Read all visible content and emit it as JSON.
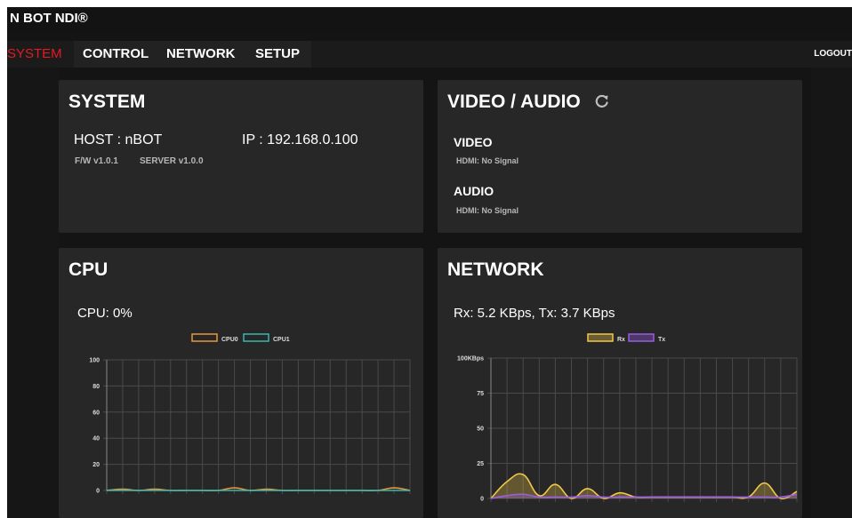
{
  "app": {
    "title": "N BOT NDI®"
  },
  "nav": {
    "tabs": [
      {
        "label": "SYSTEM",
        "active": true
      },
      {
        "label": "CONTROL",
        "active": false
      },
      {
        "label": "NETWORK",
        "active": false
      },
      {
        "label": "SETUP",
        "active": false
      }
    ],
    "logout_label": "LOGOUT"
  },
  "colors": {
    "accent_active_tab": "#e31b23",
    "panel_bg": "#272727",
    "page_bg": "#141414",
    "cpu0": "#e8973a",
    "cpu1": "#38b7b0",
    "rx": "#f0c84a",
    "tx": "#9a5de0"
  },
  "system": {
    "title": "SYSTEM",
    "host_label": "HOST : nBOT",
    "ip_label": "IP : 192.168.0.100",
    "fw_label": "F/W v1.0.1",
    "server_label": "SERVER v1.0.0"
  },
  "video_audio": {
    "title": "VIDEO / AUDIO",
    "refresh_icon": "refresh-icon",
    "video_label": "VIDEO",
    "video_status": "HDMI: No Signal",
    "audio_label": "AUDIO",
    "audio_status": "HDMI: No Signal"
  },
  "cpu": {
    "title": "CPU",
    "usage_label": "CPU: 0%"
  },
  "network": {
    "title": "NETWORK",
    "rate_label": "Rx: 5.2 KBps, Tx: 3.7 KBps"
  },
  "chart_data": [
    {
      "type": "line",
      "name": "cpu",
      "ylim": [
        0,
        100
      ],
      "y_ticks": [
        "0",
        "20",
        "40",
        "60",
        "80",
        "100"
      ],
      "x_count": 20,
      "series": [
        {
          "name": "CPU0",
          "values": [
            0,
            1,
            0,
            1,
            0,
            0,
            0,
            0,
            2,
            0,
            1,
            0,
            0,
            0,
            0,
            0,
            0,
            0,
            2,
            0
          ]
        },
        {
          "name": "CPU1",
          "values": [
            0,
            0,
            0,
            0,
            0,
            0,
            0,
            0,
            0,
            0,
            0,
            0,
            0,
            0,
            0,
            0,
            0,
            0,
            0,
            0
          ]
        }
      ],
      "grid": true,
      "legend": "top-center"
    },
    {
      "type": "area",
      "name": "network",
      "ylim": [
        0,
        100
      ],
      "y_ticks": [
        "0",
        "25",
        "50",
        "75",
        "100KBps"
      ],
      "x_count": 20,
      "series": [
        {
          "name": "Rx",
          "values": [
            0,
            12,
            17,
            2,
            10,
            0,
            7,
            0,
            4,
            1,
            1,
            1,
            1,
            1,
            1,
            1,
            1,
            11,
            0,
            5
          ]
        },
        {
          "name": "Tx",
          "values": [
            0,
            2,
            3,
            1,
            1,
            1,
            2,
            1,
            1,
            1,
            1,
            1,
            1,
            1,
            1,
            1,
            1,
            1,
            1,
            3
          ]
        }
      ],
      "grid": true,
      "legend": "top-center"
    }
  ]
}
